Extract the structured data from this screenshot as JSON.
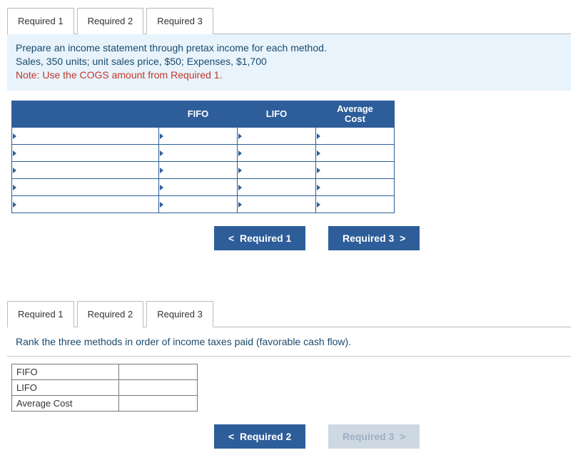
{
  "section2": {
    "tabs": [
      "Required 1",
      "Required 2",
      "Required 3"
    ],
    "active_tab_index": 1,
    "instruction_line1": "Prepare an income statement through pretax income for each method.",
    "instruction_line2": "Sales, 350 units; unit sales price, $50; Expenses, $1,700",
    "instruction_note": "Note: Use the COGS amount from Required 1.",
    "columns": {
      "fifo": "FIFO",
      "lifo": "LIFO",
      "avg": "Average\nCost"
    },
    "rows": 5,
    "nav_prev": "Required 1",
    "nav_next": "Required 3"
  },
  "section3": {
    "tabs": [
      "Required 1",
      "Required 2",
      "Required 3"
    ],
    "active_tab_index": 2,
    "instruction": "Rank the three methods in order of income taxes paid (favorable cash flow).",
    "rank_rows": [
      "FIFO",
      "LIFO",
      "Average Cost"
    ],
    "nav_prev": "Required 2",
    "nav_next": "Required 3"
  }
}
